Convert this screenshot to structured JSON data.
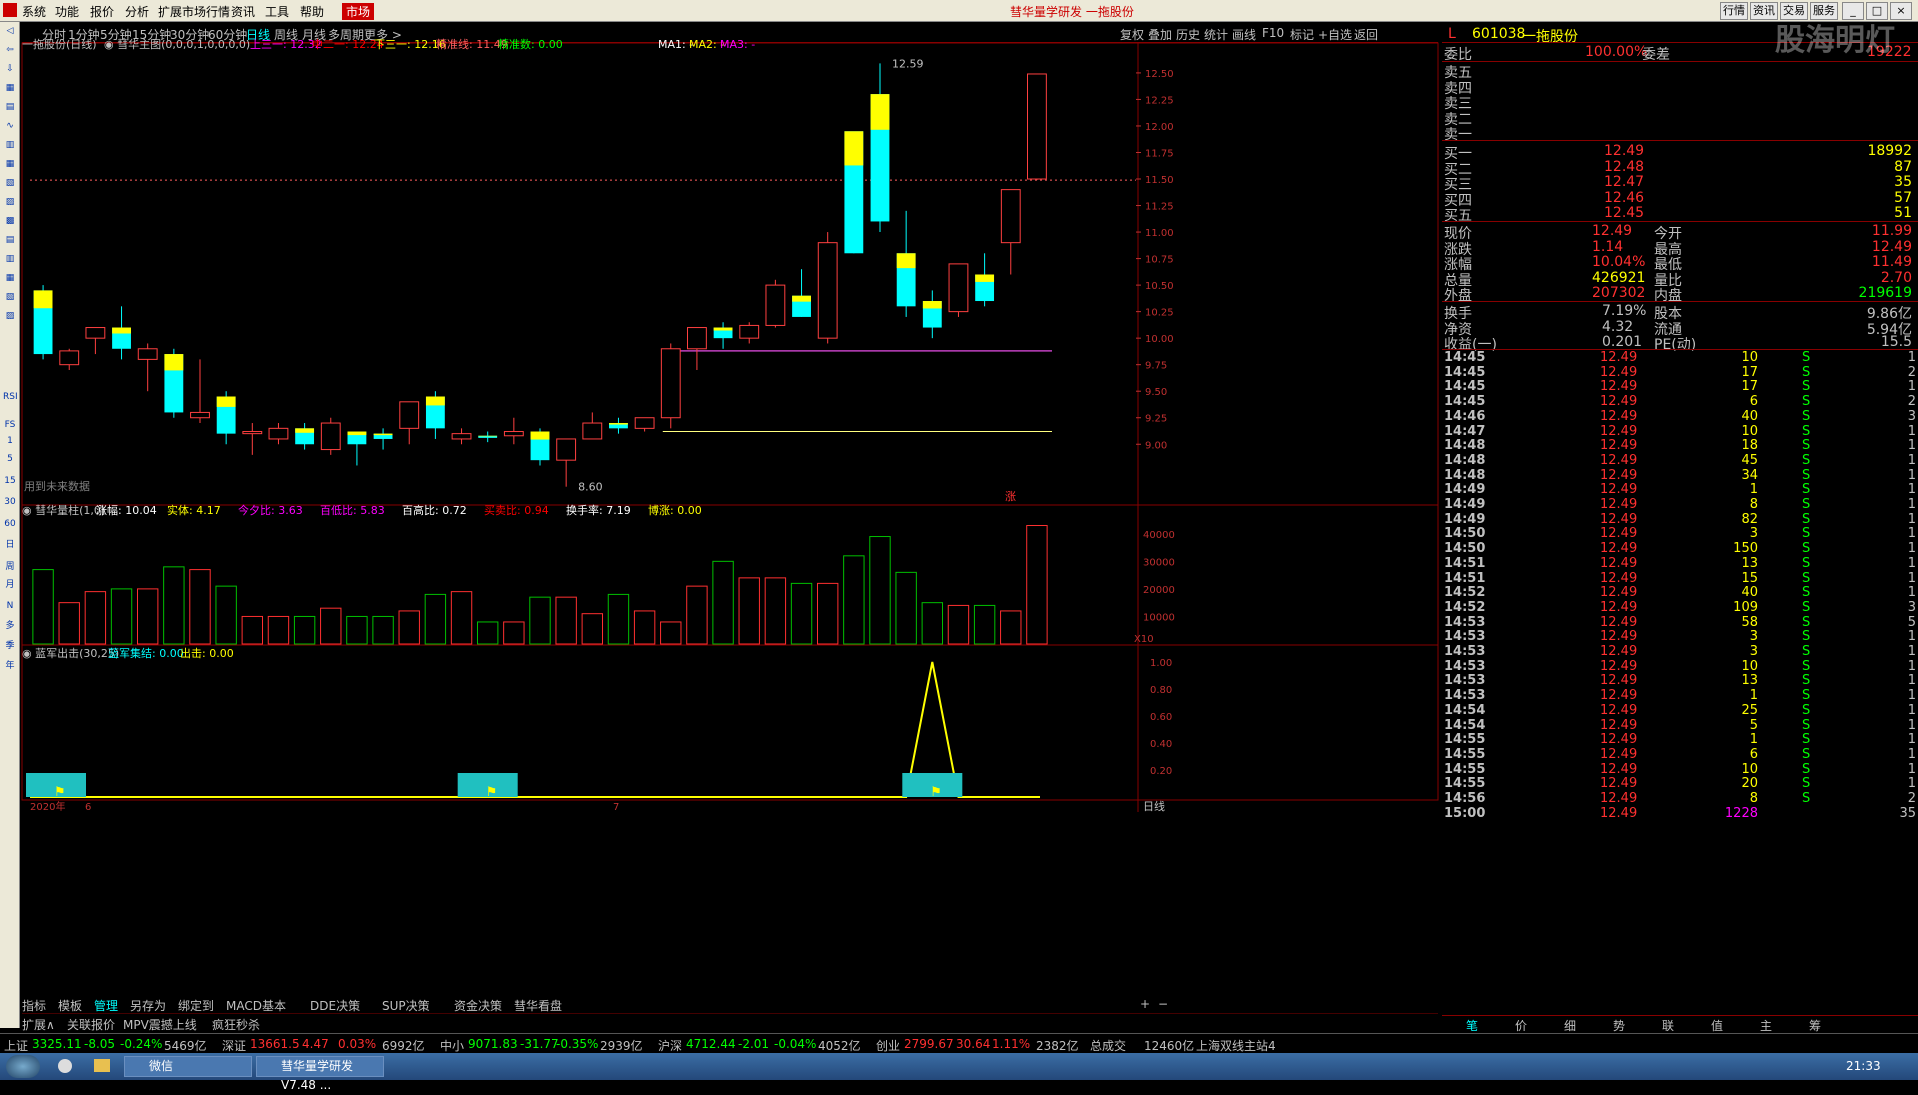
{
  "menu": {
    "items": [
      "系统",
      "功能",
      "报价",
      "分析",
      "扩展市场行情",
      "资讯",
      "工具",
      "帮助"
    ],
    "active": "市场",
    "title": "彗华量学研发  一拖股份",
    "right_buttons": [
      "行情",
      "资讯",
      "交易",
      "服务"
    ]
  },
  "period_bar": {
    "items": [
      "分时",
      "1分钟",
      "5分钟",
      "15分钟",
      "30分钟",
      "60分钟",
      "日线",
      "周线",
      "月线",
      "多周期",
      "更多 >"
    ],
    "selected": "日线",
    "right_items": [
      "复权",
      "叠加",
      "历史",
      "统计",
      "画线",
      "F10",
      "标记",
      "+自选",
      "返回"
    ]
  },
  "left_toolbar": {
    "labels": [
      "RSI",
      "FS",
      "1",
      "5",
      "15",
      "30",
      "60",
      "日",
      "周",
      "月",
      "N",
      "多",
      "季",
      "年"
    ]
  },
  "main_chart": {
    "stock_label": "一拖股份(日线)",
    "indicator_name": "彗华主图(0,0,0,1,0,0,0,0)",
    "lines": [
      {
        "label": "上三一:",
        "value": "12.32",
        "color": "#ff00ff"
      },
      {
        "label": "中二一:",
        "value": "12.24",
        "color": "#ff0000"
      },
      {
        "label": "下三一:",
        "value": "12.16",
        "color": "#ffff00"
      },
      {
        "label": "精准线:",
        "value": "11.49",
        "color": "#ff6060"
      },
      {
        "label": "精准数:",
        "value": "0.00",
        "color": "#00ff00"
      }
    ],
    "ma": [
      {
        "label": "MA1: -",
        "color": "#ffffff"
      },
      {
        "label": "MA2: -",
        "color": "#ffff00"
      },
      {
        "label": "MA3: -",
        "color": "#ff00ff"
      }
    ],
    "high_label": "12.59",
    "low_label": "8.60",
    "note": "用到未来数据",
    "zhang_mark": "涨",
    "y_axis": [
      "12.50",
      "12.25",
      "12.00",
      "11.75",
      "11.50",
      "11.25",
      "11.00",
      "10.75",
      "10.50",
      "10.25",
      "10.00",
      "9.75",
      "9.50",
      "9.25",
      "9.00"
    ]
  },
  "volume_panel": {
    "name": "彗华量柱(1,0)",
    "fields": [
      {
        "label": "涨幅:",
        "value": "10.04",
        "color": "#ffffff"
      },
      {
        "label": "实体:",
        "value": "4.17",
        "color": "#ffff00"
      },
      {
        "label": "今夕比:",
        "value": "3.63",
        "color": "#ff00ff"
      },
      {
        "label": "百低比:",
        "value": "5.83",
        "color": "#ff00ff"
      },
      {
        "label": "百高比:",
        "value": "0.72",
        "color": "#ffffff"
      },
      {
        "label": "买卖比:",
        "value": "0.94",
        "color": "#ff0000"
      },
      {
        "label": "换手率:",
        "value": "7.19",
        "color": "#ffffff"
      },
      {
        "label": "博涨:",
        "value": "0.00",
        "color": "#ffff00"
      }
    ],
    "y_axis": [
      "40000",
      "30000",
      "20000",
      "10000"
    ],
    "unit": "X10"
  },
  "signal_panel": {
    "name": "蓝军出击(30,25)",
    "fields": [
      {
        "label": "蓝军集结:",
        "value": "0.00",
        "color": "#00ffff"
      },
      {
        "label": "出击:",
        "value": "0.00",
        "color": "#ffff00"
      }
    ],
    "y_axis": [
      "1.00",
      "0.80",
      "0.60",
      "0.40",
      "0.20"
    ],
    "x_labels": [
      "2020年",
      "6",
      "7"
    ],
    "period_label": "日线"
  },
  "chart_data": {
    "type": "candlestick",
    "candles": [
      {
        "o": 10.45,
        "h": 10.5,
        "l": 9.8,
        "c": 9.85,
        "up": false
      },
      {
        "o": 9.75,
        "h": 9.9,
        "l": 9.7,
        "c": 9.88,
        "up": true
      },
      {
        "o": 10.0,
        "h": 10.1,
        "l": 9.85,
        "c": 10.1,
        "up": true
      },
      {
        "o": 10.1,
        "h": 10.3,
        "l": 9.8,
        "c": 9.9,
        "up": false
      },
      {
        "o": 9.9,
        "h": 9.95,
        "l": 9.5,
        "c": 9.8,
        "up": true
      },
      {
        "o": 9.85,
        "h": 9.9,
        "l": 9.25,
        "c": 9.3,
        "up": false
      },
      {
        "o": 9.25,
        "h": 9.8,
        "l": 9.2,
        "c": 9.3,
        "up": true
      },
      {
        "o": 9.45,
        "h": 9.5,
        "l": 9.0,
        "c": 9.1,
        "up": false
      },
      {
        "o": 9.12,
        "h": 9.2,
        "l": 8.9,
        "c": 9.1,
        "up": true
      },
      {
        "o": 9.05,
        "h": 9.2,
        "l": 9.0,
        "c": 9.15,
        "up": true
      },
      {
        "o": 9.15,
        "h": 9.2,
        "l": 8.95,
        "c": 9.0,
        "up": false
      },
      {
        "o": 8.95,
        "h": 9.25,
        "l": 8.9,
        "c": 9.2,
        "up": true
      },
      {
        "o": 9.0,
        "h": 9.1,
        "l": 8.8,
        "c": 9.12,
        "up": false
      },
      {
        "o": 9.1,
        "h": 9.15,
        "l": 8.95,
        "c": 9.05,
        "up": false
      },
      {
        "o": 9.15,
        "h": 9.2,
        "l": 9.0,
        "c": 9.4,
        "up": true
      },
      {
        "o": 9.45,
        "h": 9.5,
        "l": 9.05,
        "c": 9.15,
        "up": false
      },
      {
        "o": 9.05,
        "h": 9.15,
        "l": 9.0,
        "c": 9.1,
        "up": true
      },
      {
        "o": 9.08,
        "h": 9.12,
        "l": 9.02,
        "c": 9.06,
        "up": false
      },
      {
        "o": 9.08,
        "h": 9.25,
        "l": 9.0,
        "c": 9.12,
        "up": true
      },
      {
        "o": 9.12,
        "h": 9.15,
        "l": 8.8,
        "c": 8.85,
        "up": false
      },
      {
        "o": 8.85,
        "h": 9.0,
        "l": 8.6,
        "c": 9.05,
        "up": true
      },
      {
        "o": 9.05,
        "h": 9.3,
        "l": 9.05,
        "c": 9.2,
        "up": true
      },
      {
        "o": 9.2,
        "h": 9.25,
        "l": 9.1,
        "c": 9.15,
        "up": false
      },
      {
        "o": 9.15,
        "h": 9.25,
        "l": 9.12,
        "c": 9.25,
        "up": true
      },
      {
        "o": 9.25,
        "h": 9.95,
        "l": 9.15,
        "c": 9.9,
        "up": true
      },
      {
        "o": 9.9,
        "h": 10.1,
        "l": 9.7,
        "c": 10.1,
        "up": true
      },
      {
        "o": 10.1,
        "h": 10.15,
        "l": 9.9,
        "c": 10.0,
        "up": false
      },
      {
        "o": 10.0,
        "h": 10.15,
        "l": 9.95,
        "c": 10.12,
        "up": true
      },
      {
        "o": 10.12,
        "h": 10.55,
        "l": 10.1,
        "c": 10.5,
        "up": true
      },
      {
        "o": 10.4,
        "h": 10.65,
        "l": 10.2,
        "c": 10.2,
        "up": false
      },
      {
        "o": 10.0,
        "h": 11.0,
        "l": 9.95,
        "c": 10.9,
        "up": true
      },
      {
        "o": 10.8,
        "h": 11.8,
        "l": 10.8,
        "c": 11.95,
        "up": false
      },
      {
        "o": 11.1,
        "h": 12.59,
        "l": 11.0,
        "c": 12.3,
        "up": false
      },
      {
        "o": 10.8,
        "h": 11.2,
        "l": 10.2,
        "c": 10.3,
        "up": false
      },
      {
        "o": 10.35,
        "h": 10.45,
        "l": 10.0,
        "c": 10.1,
        "up": false
      },
      {
        "o": 10.25,
        "h": 10.7,
        "l": 10.2,
        "c": 10.7,
        "up": true
      },
      {
        "o": 10.6,
        "h": 10.8,
        "l": 10.3,
        "c": 10.35,
        "up": false
      },
      {
        "o": 10.9,
        "h": 11.4,
        "l": 10.6,
        "c": 11.4,
        "up": true
      },
      {
        "o": 11.5,
        "h": 12.49,
        "l": 11.49,
        "c": 12.49,
        "up": true
      }
    ],
    "volumes": [
      27000,
      15000,
      19000,
      20000,
      20000,
      28000,
      27000,
      21000,
      10000,
      10000,
      10000,
      13000,
      10000,
      10000,
      12000,
      18000,
      19000,
      8000,
      8000,
      17000,
      17000,
      11000,
      18000,
      12000,
      8000,
      21000,
      30000,
      24000,
      24000,
      22000,
      22000,
      32000,
      39000,
      26000,
      15000,
      14000,
      14000,
      12000,
      43000
    ],
    "signal": [
      0,
      0,
      0,
      0,
      0,
      0,
      0,
      0,
      0,
      0,
      0,
      0,
      0,
      0,
      0,
      0,
      0,
      0,
      0,
      0,
      0,
      0,
      0,
      0,
      0,
      0,
      0,
      0,
      0,
      0,
      0,
      0,
      0,
      0,
      1,
      0,
      0,
      0,
      0
    ],
    "ylim": [
      8.55,
      12.65
    ],
    "vol_ylim": [
      0,
      45000
    ]
  },
  "quote": {
    "mark": "L",
    "code": "601038",
    "name": "一拖股份",
    "weibi_label": "委比",
    "weibi": "100.00%",
    "weicha_label": "委差",
    "weicha": "19222",
    "sell": [
      {
        "label": "卖五",
        "price": "",
        "vol": ""
      },
      {
        "label": "卖四",
        "price": "",
        "vol": ""
      },
      {
        "label": "卖三",
        "price": "",
        "vol": ""
      },
      {
        "label": "卖二",
        "price": "",
        "vol": ""
      },
      {
        "label": "卖一",
        "price": "",
        "vol": ""
      }
    ],
    "buy": [
      {
        "label": "买一",
        "price": "12.49",
        "vol": "18992"
      },
      {
        "label": "买二",
        "price": "12.48",
        "vol": "87"
      },
      {
        "label": "买三",
        "price": "12.47",
        "vol": "35"
      },
      {
        "label": "买四",
        "price": "12.46",
        "vol": "57"
      },
      {
        "label": "买五",
        "price": "12.45",
        "vol": "51"
      }
    ],
    "stats": [
      {
        "l1": "现价",
        "v1": "12.49",
        "l2": "今开",
        "v2": "11.99",
        "c1": "#ff3030",
        "c2": "#ff3030"
      },
      {
        "l1": "涨跌",
        "v1": "1.14",
        "l2": "最高",
        "v2": "12.49",
        "c1": "#ff3030",
        "c2": "#ff3030"
      },
      {
        "l1": "涨幅",
        "v1": "10.04%",
        "l2": "最低",
        "v2": "11.49",
        "c1": "#ff3030",
        "c2": "#ff3030"
      },
      {
        "l1": "总量",
        "v1": "426921",
        "l2": "量比",
        "v2": "2.70",
        "c1": "#ffff00",
        "c2": "#ff3030"
      },
      {
        "l1": "外盘",
        "v1": "207302",
        "l2": "内盘",
        "v2": "219619",
        "c1": "#ff3030",
        "c2": "#00ff00"
      }
    ],
    "stats2": [
      {
        "l1": "换手",
        "v1": "7.19%",
        "l2": "股本",
        "v2": "9.86亿"
      },
      {
        "l1": "净资",
        "v1": "4.32",
        "l2": "流通",
        "v2": "5.94亿"
      },
      {
        "l1": "收益(一)",
        "v1": "0.201",
        "l2": "PE(动)",
        "v2": "15.5"
      }
    ]
  },
  "trades": [
    {
      "t": "14:45",
      "p": "12.49",
      "v": "10",
      "s": "S",
      "n": "1"
    },
    {
      "t": "14:45",
      "p": "12.49",
      "v": "17",
      "s": "S",
      "n": "2"
    },
    {
      "t": "14:45",
      "p": "12.49",
      "v": "17",
      "s": "S",
      "n": "1"
    },
    {
      "t": "14:45",
      "p": "12.49",
      "v": "6",
      "s": "S",
      "n": "2"
    },
    {
      "t": "14:46",
      "p": "12.49",
      "v": "40",
      "s": "S",
      "n": "3"
    },
    {
      "t": "14:47",
      "p": "12.49",
      "v": "10",
      "s": "S",
      "n": "1"
    },
    {
      "t": "14:48",
      "p": "12.49",
      "v": "18",
      "s": "S",
      "n": "1"
    },
    {
      "t": "14:48",
      "p": "12.49",
      "v": "45",
      "s": "S",
      "n": "1"
    },
    {
      "t": "14:48",
      "p": "12.49",
      "v": "34",
      "s": "S",
      "n": "1"
    },
    {
      "t": "14:49",
      "p": "12.49",
      "v": "1",
      "s": "S",
      "n": "1"
    },
    {
      "t": "14:49",
      "p": "12.49",
      "v": "8",
      "s": "S",
      "n": "1"
    },
    {
      "t": "14:49",
      "p": "12.49",
      "v": "82",
      "s": "S",
      "n": "1"
    },
    {
      "t": "14:50",
      "p": "12.49",
      "v": "3",
      "s": "S",
      "n": "1"
    },
    {
      "t": "14:50",
      "p": "12.49",
      "v": "150",
      "s": "S",
      "n": "1"
    },
    {
      "t": "14:51",
      "p": "12.49",
      "v": "13",
      "s": "S",
      "n": "1"
    },
    {
      "t": "14:51",
      "p": "12.49",
      "v": "15",
      "s": "S",
      "n": "1"
    },
    {
      "t": "14:52",
      "p": "12.49",
      "v": "40",
      "s": "S",
      "n": "1"
    },
    {
      "t": "14:52",
      "p": "12.49",
      "v": "109",
      "s": "S",
      "n": "3"
    },
    {
      "t": "14:53",
      "p": "12.49",
      "v": "58",
      "s": "S",
      "n": "5"
    },
    {
      "t": "14:53",
      "p": "12.49",
      "v": "3",
      "s": "S",
      "n": "1"
    },
    {
      "t": "14:53",
      "p": "12.49",
      "v": "3",
      "s": "S",
      "n": "1"
    },
    {
      "t": "14:53",
      "p": "12.49",
      "v": "10",
      "s": "S",
      "n": "1"
    },
    {
      "t": "14:53",
      "p": "12.49",
      "v": "13",
      "s": "S",
      "n": "1"
    },
    {
      "t": "14:53",
      "p": "12.49",
      "v": "1",
      "s": "S",
      "n": "1"
    },
    {
      "t": "14:54",
      "p": "12.49",
      "v": "25",
      "s": "S",
      "n": "1"
    },
    {
      "t": "14:54",
      "p": "12.49",
      "v": "5",
      "s": "S",
      "n": "1"
    },
    {
      "t": "14:55",
      "p": "12.49",
      "v": "1",
      "s": "S",
      "n": "1"
    },
    {
      "t": "14:55",
      "p": "12.49",
      "v": "6",
      "s": "S",
      "n": "1"
    },
    {
      "t": "14:55",
      "p": "12.49",
      "v": "10",
      "s": "S",
      "n": "1"
    },
    {
      "t": "14:55",
      "p": "12.49",
      "v": "20",
      "s": "S",
      "n": "1"
    },
    {
      "t": "14:56",
      "p": "12.49",
      "v": "8",
      "s": "S",
      "n": "2"
    },
    {
      "t": "15:00",
      "p": "12.49",
      "v": "1228",
      "s": "",
      "n": "35"
    }
  ],
  "right_tabs": [
    "笔",
    "价",
    "细",
    "势",
    "联",
    "值",
    "主",
    "筹"
  ],
  "formula_bar": [
    "指标",
    "模板",
    "管理",
    "另存为",
    "绑定到",
    "MACD基本",
    "DDE决策",
    "SUP决策",
    "资金决策",
    "彗华看盘"
  ],
  "formula_bar2": [
    "扩展∧",
    "关联报价",
    "MPV震撼上线",
    "疯狂秒杀"
  ],
  "status": [
    {
      "label": "上证",
      "v1": "3325.11",
      "v2": "-8.05",
      "v3": "-0.24%",
      "v4": "5469亿"
    },
    {
      "label": "深证",
      "v1": "13661.5",
      "v2": "4.47",
      "v3": "0.03%",
      "v4": "6992亿"
    },
    {
      "label": "中小",
      "v1": "9071.83",
      "v2": "-31.77",
      "v3": "-0.35%",
      "v4": "2939亿"
    },
    {
      "label": "沪深",
      "v1": "4712.44",
      "v2": "-2.01",
      "v3": "-0.04%",
      "v4": "4052亿"
    },
    {
      "label": "创业",
      "v1": "2799.67",
      "v2": "30.64",
      "v3": "1.11%",
      "v4": "2382亿"
    }
  ],
  "status_extra": {
    "total_label": "总成交",
    "total": "12460亿",
    "station": "上海双线主站4"
  },
  "taskbar": {
    "items": [
      "微信",
      "彗华量学研发V7.48 ..."
    ],
    "time": "21:33"
  },
  "watermark": "股海明灯"
}
